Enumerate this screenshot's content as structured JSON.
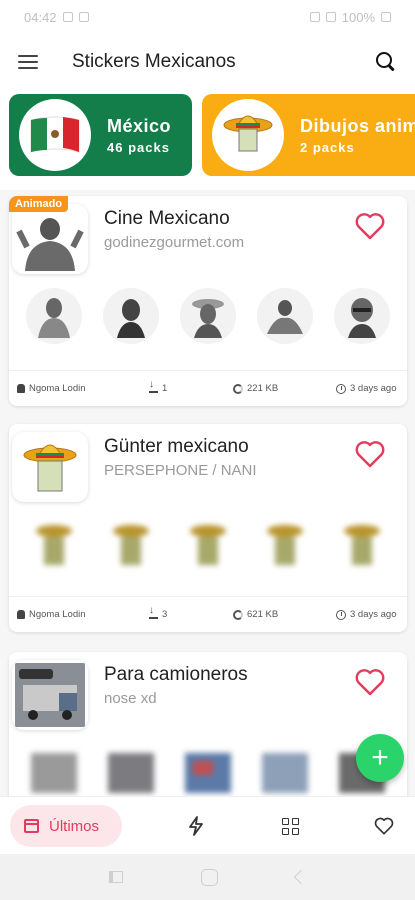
{
  "status_bar": {
    "time": "04:42",
    "battery": "100%"
  },
  "app_bar": {
    "title": "Stickers Mexicanos"
  },
  "categories": [
    {
      "name": "México",
      "count": "46 packs",
      "color": "#137e4a"
    },
    {
      "name": "Dibujos animados",
      "count": "2 packs",
      "color": "#f9ad12"
    }
  ],
  "packs": [
    {
      "badge": "Animado",
      "title": "Cine Mexicano",
      "subtitle": "godinezgourmet.com",
      "author": "Ngoma Lodin",
      "downloads": "1",
      "size": "221 KB",
      "time": "3 days ago"
    },
    {
      "title": "Günter mexicano",
      "subtitle": "PERSEPHONE / NANI",
      "author": "Ngoma Lodin",
      "downloads": "3",
      "size": "621 KB",
      "time": "3 days ago"
    },
    {
      "title": "Para camioneros",
      "subtitle": "nose xd"
    }
  ],
  "bottom_nav": {
    "active_label": "Últimos"
  },
  "colors": {
    "accent": "#e23b5d",
    "fab": "#2bd36b",
    "badge": "#f7941d"
  },
  "icons": [
    "menu-icon",
    "search-icon",
    "heart-icon",
    "user-icon",
    "download-icon",
    "size-icon",
    "clock-icon",
    "plus-icon",
    "store-icon",
    "bolt-icon",
    "grid-icon"
  ]
}
